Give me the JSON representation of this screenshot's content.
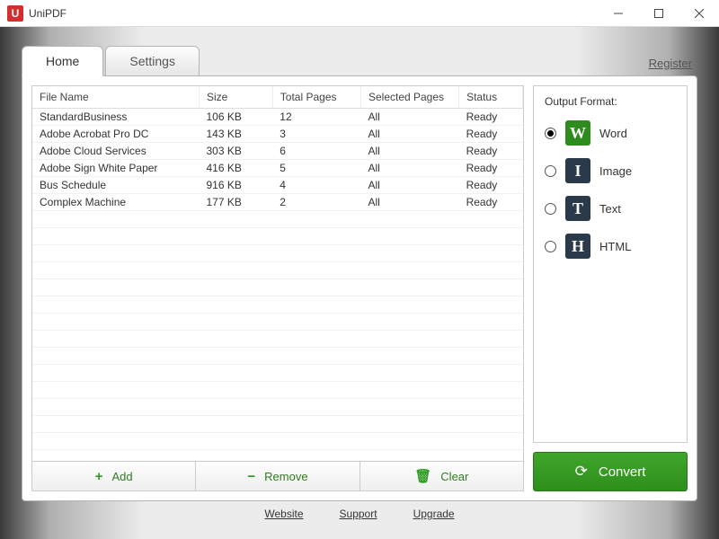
{
  "app": {
    "title": "UniPDF",
    "icon_letter": "U"
  },
  "tabs": {
    "home": "Home",
    "settings": "Settings"
  },
  "register": "Register",
  "table": {
    "headers": {
      "name": "File Name",
      "size": "Size",
      "pages": "Total Pages",
      "selected": "Selected Pages",
      "status": "Status"
    },
    "rows": [
      {
        "name": "StandardBusiness",
        "size": "106 KB",
        "pages": "12",
        "selected": "All",
        "status": "Ready"
      },
      {
        "name": "Adobe Acrobat Pro DC",
        "size": "143 KB",
        "pages": "3",
        "selected": "All",
        "status": "Ready"
      },
      {
        "name": "Adobe Cloud Services",
        "size": "303 KB",
        "pages": "6",
        "selected": "All",
        "status": "Ready"
      },
      {
        "name": "Adobe Sign White Paper",
        "size": "416 KB",
        "pages": "5",
        "selected": "All",
        "status": "Ready"
      },
      {
        "name": "Bus Schedule",
        "size": "916 KB",
        "pages": "4",
        "selected": "All",
        "status": "Ready"
      },
      {
        "name": "Complex Machine",
        "size": "177 KB",
        "pages": "2",
        "selected": "All",
        "status": "Ready"
      }
    ]
  },
  "actions": {
    "add": "Add",
    "remove": "Remove",
    "clear": "Clear"
  },
  "output": {
    "title": "Output Format:",
    "options": [
      {
        "label": "Word",
        "letter": "W",
        "color": "#2e8b1e",
        "selected": true
      },
      {
        "label": "Image",
        "letter": "I",
        "color": "#2b3a4a",
        "selected": false
      },
      {
        "label": "Text",
        "letter": "T",
        "color": "#2b3a4a",
        "selected": false
      },
      {
        "label": "HTML",
        "letter": "H",
        "color": "#2b3a4a",
        "selected": false
      }
    ]
  },
  "convert": "Convert",
  "footer": {
    "website": "Website",
    "support": "Support",
    "upgrade": "Upgrade"
  }
}
